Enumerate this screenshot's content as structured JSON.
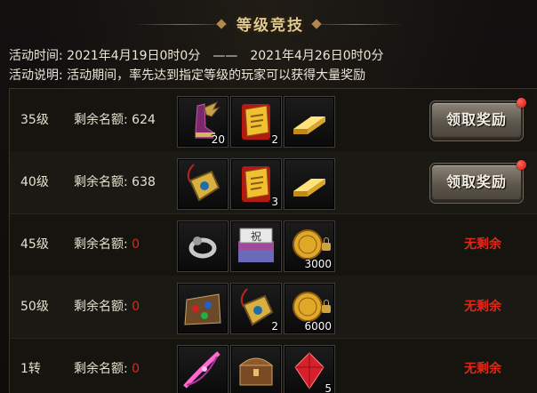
{
  "header": {
    "title": "等级竞技"
  },
  "activity": {
    "time_label": "活动时间: ",
    "start": "2021年4月19日0时0分",
    "separator": "——",
    "end": "2021年4月26日0时0分",
    "desc_label": "活动说明: ",
    "desc": "活动期间，率先达到指定等级的玩家可以获得大量奖励"
  },
  "quota_label": "剩余名额: ",
  "claim_label": "领取奖励",
  "none_label": "无剩余",
  "rows": [
    {
      "level": "35级",
      "remaining": "624",
      "claimable": true,
      "items": [
        {
          "icon": "winged-boots-icon",
          "count": "20"
        },
        {
          "icon": "gold-ticket-icon",
          "count": "2"
        },
        {
          "icon": "gold-bar-icon",
          "count": ""
        }
      ]
    },
    {
      "level": "40级",
      "remaining": "638",
      "claimable": true,
      "items": [
        {
          "icon": "gold-amulet-icon",
          "count": ""
        },
        {
          "icon": "gold-ticket-icon",
          "count": "3"
        },
        {
          "icon": "gold-bar-icon",
          "count": ""
        }
      ]
    },
    {
      "level": "45级",
      "remaining": "0",
      "claimable": false,
      "items": [
        {
          "icon": "silver-ring-icon",
          "count": ""
        },
        {
          "icon": "skill-book-icon",
          "count": ""
        },
        {
          "icon": "gold-coin-icon",
          "count": "3000"
        }
      ]
    },
    {
      "level": "50级",
      "remaining": "0",
      "claimable": false,
      "items": [
        {
          "icon": "gem-pouch-icon",
          "count": ""
        },
        {
          "icon": "gold-amulet-icon",
          "count": "2"
        },
        {
          "icon": "gold-coin-icon",
          "count": "6000"
        }
      ]
    },
    {
      "level": "1转",
      "remaining": "0",
      "claimable": false,
      "items": [
        {
          "icon": "pink-bow-icon",
          "count": ""
        },
        {
          "icon": "treasure-chest-icon",
          "count": ""
        },
        {
          "icon": "red-gem-icon",
          "count": "5"
        }
      ]
    }
  ]
}
